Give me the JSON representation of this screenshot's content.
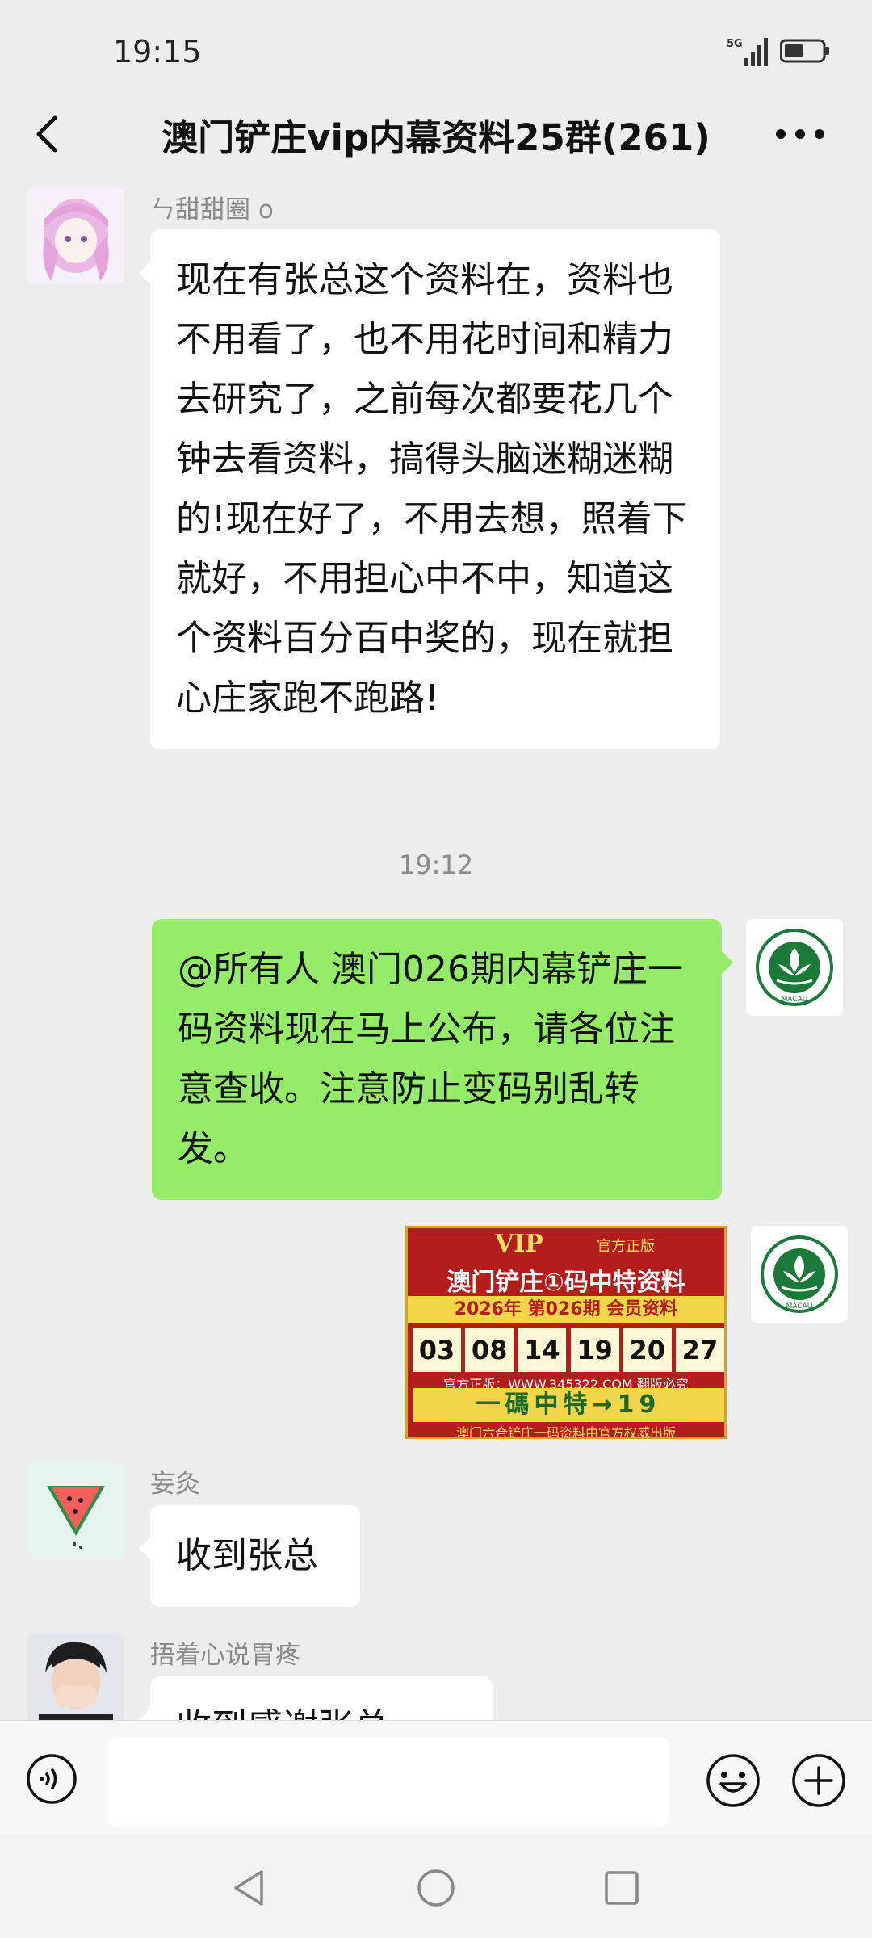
{
  "status_bar": {
    "time": "19:15",
    "network": "5G"
  },
  "header": {
    "title": "澳门铲庄vip内幕资料25群(261)"
  },
  "messages": [
    {
      "sender": "ㄣ甜甜圈 o",
      "text": "现在有张总这个资料在，资料也不用看了，也不用花时间和精力去研究了，之前每次都要花几个钟去看资料，搞得头脑迷糊迷糊的!现在好了，不用去想，照着下就好，不用担心中不中，知道这个资料百分百中奖的，现在就担心庄家跑不跑路!"
    },
    {
      "timestamp": "19:12"
    },
    {
      "self": true,
      "text": "@所有人 澳门026期内幕铲庄一码资料现在马上公布，请各位注意查收。注意防止变码别乱转发。"
    },
    {
      "self": true,
      "image": {
        "vip": "VIP",
        "tag": "官方正版",
        "title": "澳门铲庄①码中特资料",
        "year_line": "2026年 第026期 会员资料",
        "numbers": [
          "03",
          "08",
          "14",
          "19",
          "20",
          "27"
        ],
        "site": "官方正版：WWW.345322.COM 翻版必究",
        "banner": "一碼中特→19",
        "footer": "澳门六合铲庄一码资料由官方权威出版"
      }
    },
    {
      "sender": "妄灸",
      "text": "收到张总"
    },
    {
      "sender": "捂着心说胃疼",
      "text": "收到感谢张总"
    }
  ],
  "avatar_labels": {
    "macau": "MACAU"
  },
  "input": {
    "placeholder": ""
  },
  "colors": {
    "background": "#ededed",
    "self_bubble": "#95ec69",
    "other_bubble": "#ffffff"
  },
  "icons": {
    "back": "chevron-left-icon",
    "more": "more-dots-icon",
    "voice": "voice-icon",
    "emoji": "emoji-icon",
    "plus": "plus-icon",
    "nav_back": "triangle-back-icon",
    "nav_home": "circle-home-icon",
    "nav_recent": "square-recent-icon"
  }
}
